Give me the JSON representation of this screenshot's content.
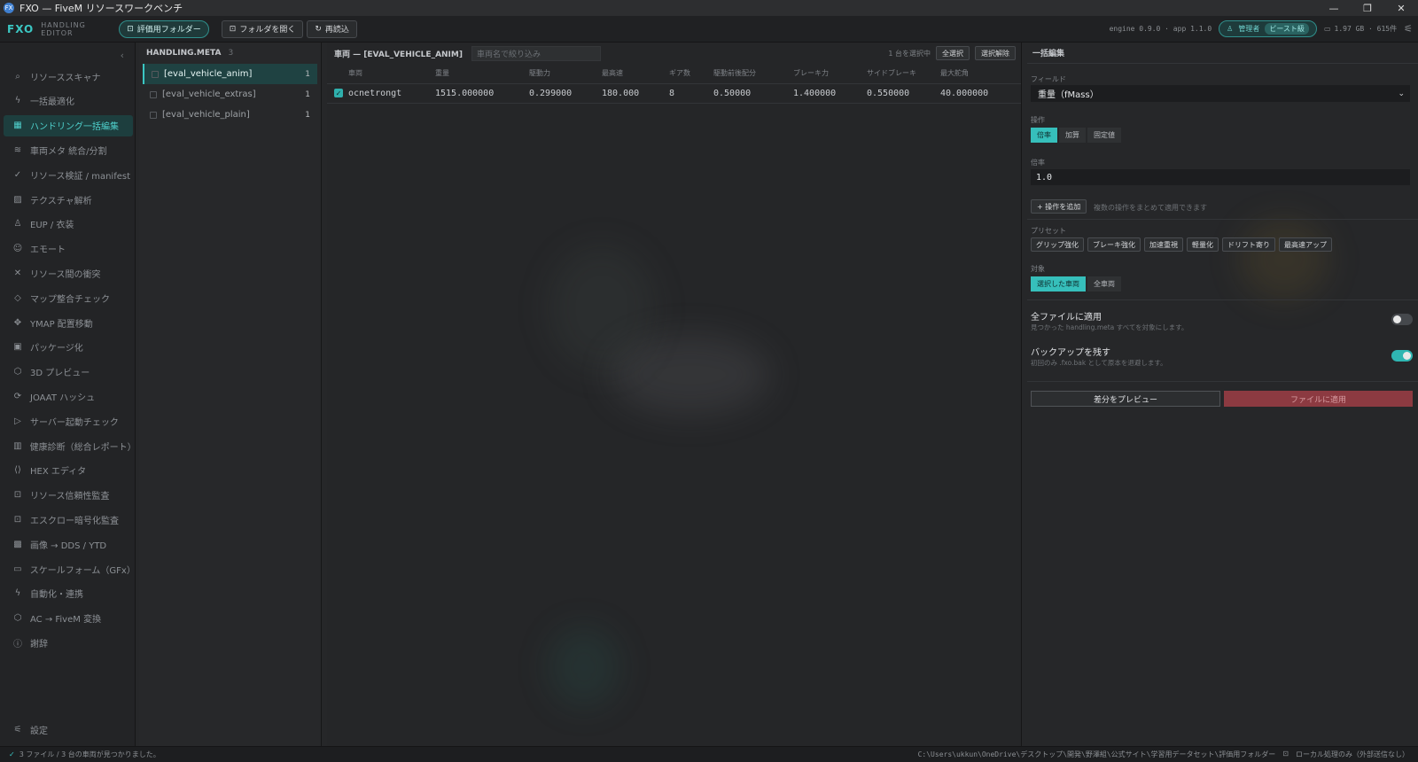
{
  "window": {
    "title": "FXO — FiveM リソースワークベンチ",
    "app_icon_text": "FX",
    "controls": {
      "minimize": "—",
      "restore": "❐",
      "close": "✕"
    }
  },
  "toolbar": {
    "brand": "FXO",
    "subtitle": "HANDLING EDITOR",
    "eval_folder": "評価用フォルダー",
    "open_folder": "フォルダを開く",
    "reload": "再読込",
    "version": "engine 0.9.0 · app 1.1.0",
    "user": "管理者",
    "user_tag": "ビースト級",
    "stats": "1.97 GB · 615件"
  },
  "sidebar": {
    "items": [
      {
        "label": "リソーススキャナ",
        "icon": "search-icon",
        "glyph": "⌕"
      },
      {
        "label": "一括最適化",
        "icon": "bolt-icon",
        "glyph": "ϟ"
      },
      {
        "label": "ハンドリング一括編集",
        "icon": "grid-icon",
        "glyph": "▦",
        "active": true
      },
      {
        "label": "車両メタ 統合/分割",
        "icon": "layers-icon",
        "glyph": "≋"
      },
      {
        "label": "リソース検証 / manifest",
        "icon": "check-circle-icon",
        "glyph": "✓"
      },
      {
        "label": "テクスチャ解析",
        "icon": "image-icon",
        "glyph": "▨"
      },
      {
        "label": "EUP / 衣装",
        "icon": "person-icon",
        "glyph": "♙"
      },
      {
        "label": "エモート",
        "icon": "emote-icon",
        "glyph": "☺"
      },
      {
        "label": "リソース間の衝突",
        "icon": "cross-icon",
        "glyph": "✕"
      },
      {
        "label": "マップ整合チェック",
        "icon": "diamond-icon",
        "glyph": "◇"
      },
      {
        "label": "YMAP 配置移動",
        "icon": "move-icon",
        "glyph": "✥"
      },
      {
        "label": "パッケージ化",
        "icon": "package-icon",
        "glyph": "▣"
      },
      {
        "label": "3D プレビュー",
        "icon": "cube-icon",
        "glyph": "⬡"
      },
      {
        "label": "JOAAT ハッシュ",
        "icon": "hash-icon",
        "glyph": "⟳"
      },
      {
        "label": "サーバー起動チェック",
        "icon": "play-icon",
        "glyph": "▷"
      },
      {
        "label": "健康診断（総合レポート）",
        "icon": "chart-icon",
        "glyph": "▥"
      },
      {
        "label": "HEX エディタ",
        "icon": "code-icon",
        "glyph": "⟨⟩"
      },
      {
        "label": "リソース信頼性監査",
        "icon": "lock-icon",
        "glyph": "⊡"
      },
      {
        "label": "エスクロー暗号化監査",
        "icon": "lock-icon",
        "glyph": "⊡"
      },
      {
        "label": "画像 → DDS / YTD",
        "icon": "checker-icon",
        "glyph": "▩"
      },
      {
        "label": "スケールフォーム（GFx）",
        "icon": "monitor-icon",
        "glyph": "▭"
      },
      {
        "label": "自動化・連携",
        "icon": "bolt-icon",
        "glyph": "ϟ"
      },
      {
        "label": "AC → FiveM 変換",
        "icon": "cube-icon",
        "glyph": "⬡"
      },
      {
        "label": "謝辞",
        "icon": "info-icon",
        "glyph": "ⓘ"
      }
    ],
    "settings": {
      "label": "設定",
      "icon": "sliders-icon",
      "glyph": "⚟"
    },
    "collapse_glyph": "‹"
  },
  "files": {
    "header": "HANDLING.META",
    "count": "3",
    "items": [
      {
        "name": "[eval_vehicle_anim]",
        "count": "1"
      },
      {
        "name": "[eval_vehicle_extras]",
        "count": "1"
      },
      {
        "name": "[eval_vehicle_plain]",
        "count": "1"
      }
    ]
  },
  "vehicles": {
    "header": "車両 — [EVAL_VEHICLE_ANIM]",
    "filter_placeholder": "車両名で絞り込み",
    "selection_info": "1 台を選択中",
    "select_all": "全選択",
    "deselect": "選択解除",
    "columns": [
      "車両",
      "重量",
      "駆動力",
      "最高速",
      "ギア数",
      "駆動前後配分",
      "ブレーキ力",
      "サイドブレーキ",
      "最大舵角"
    ],
    "rows": [
      [
        "ocnetrongt",
        "1515.000000",
        "0.299000",
        "180.000",
        "8",
        "0.50000",
        "1.400000",
        "0.550000",
        "40.000000"
      ]
    ]
  },
  "bulk": {
    "header": "一括編集",
    "field_label": "フィールド",
    "field_value": "重量（fMass）",
    "op_label": "操作",
    "ops": [
      "倍率",
      "加算",
      "固定値"
    ],
    "rate_label": "倍率",
    "rate_value": "1.0",
    "add_op": "+ 操作を追加",
    "add_op_hint": "複数の操作をまとめて適用できます",
    "preset_label": "プリセット",
    "presets": [
      "グリップ強化",
      "ブレーキ強化",
      "加速重視",
      "軽量化",
      "ドリフト寄り",
      "最高速アップ"
    ],
    "target_label": "対象",
    "targets": [
      "選択した車両",
      "全車両"
    ],
    "all_files_title": "全ファイルに適用",
    "all_files_desc": "見つかった handling.meta すべてを対象にします。",
    "all_files_on": false,
    "backup_title": "バックアップを残す",
    "backup_desc": "初回のみ .fxo.bak として原本を退避します。",
    "backup_on": true,
    "preview_btn": "差分をプレビュー",
    "apply_btn": "ファイルに適用"
  },
  "status": {
    "check": "✓",
    "message": "3 ファイル / 3 台の車両が見つかりました。",
    "path": "C:\\Users\\ukkun\\OneDrive\\デスクトップ\\開発\\野澤組\\公式サイト\\学習用データセット\\評価用フォルダー",
    "local": "ローカル処理のみ（外部送信なし）"
  },
  "colors": {
    "accent": "#3bc7c3",
    "apply": "#8c3a41",
    "background": "#262729"
  }
}
